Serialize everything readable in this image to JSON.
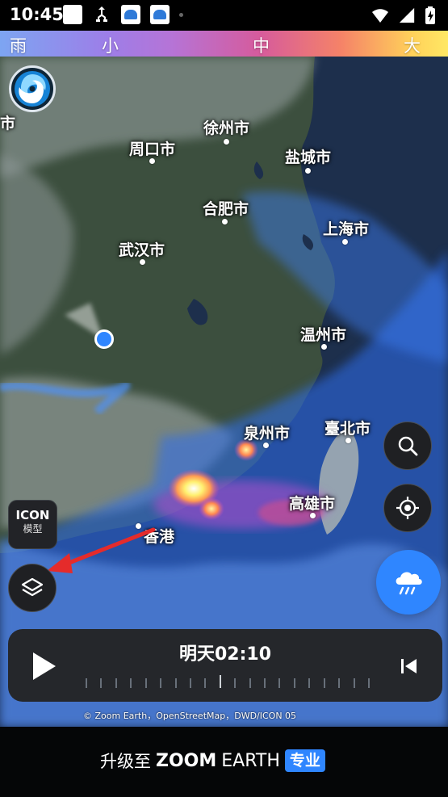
{
  "status_bar": {
    "time": "10:45",
    "left_icons": [
      "message-icon",
      "usb-icon",
      "zoom-earth-notification-icon",
      "zoom-earth-notification-icon"
    ],
    "right_icons": [
      "wifi-icon",
      "signal-icon",
      "battery-icon"
    ]
  },
  "legend": {
    "items": [
      "雨",
      "小",
      "中",
      "大"
    ]
  },
  "map": {
    "cities": [
      {
        "name": "市"
      },
      {
        "name": "徐州市"
      },
      {
        "name": "周口市"
      },
      {
        "name": "盐城市"
      },
      {
        "name": "合肥市"
      },
      {
        "name": "上海市"
      },
      {
        "name": "武汉市"
      },
      {
        "name": "温州市"
      },
      {
        "name": "泉州市"
      },
      {
        "name": "臺北市"
      },
      {
        "name": "高雄市"
      },
      {
        "name": "香港"
      }
    ]
  },
  "controls": {
    "model_label": "ICON",
    "model_sublabel": "模型",
    "search_icon": "search-icon",
    "locate_icon": "crosshair-icon",
    "rain_icon": "rain-cloud-icon",
    "layers_icon": "layers-icon"
  },
  "timeline": {
    "time": "明天02:10",
    "play_icon": "play-icon",
    "skip_icon": "skip-back-icon"
  },
  "credit": "© Zoom Earth，OpenStreetMap，DWD/ICON 05",
  "promo": {
    "text": "升级至",
    "brand_bold": "ZOOM",
    "brand_regular": "EARTH",
    "badge": "专业"
  },
  "colors": {
    "accent_blue": "#2f86ff",
    "button_dark": "#1f2023",
    "status_bg": "#000000"
  }
}
